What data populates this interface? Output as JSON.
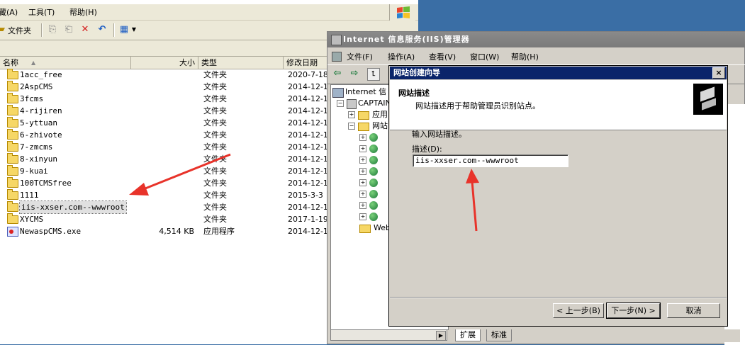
{
  "explorer": {
    "menu": [
      "藏(A)",
      "工具(T)",
      "帮助(H)"
    ],
    "toolbar_folders_label": "文件夹",
    "columns": {
      "name": "名称",
      "size": "大小",
      "type": "类型",
      "modified": "修改日期"
    },
    "rows": [
      {
        "name": "1acc_free",
        "size": "",
        "type": "文件夹",
        "date": "2020-7-18"
      },
      {
        "name": "2AspCMS",
        "size": "",
        "type": "文件夹",
        "date": "2014-12-1"
      },
      {
        "name": "3fcms",
        "size": "",
        "type": "文件夹",
        "date": "2014-12-1"
      },
      {
        "name": "4-rijiren",
        "size": "",
        "type": "文件夹",
        "date": "2014-12-1"
      },
      {
        "name": "5-yttuan",
        "size": "",
        "type": "文件夹",
        "date": "2014-12-1"
      },
      {
        "name": "6-zhivote",
        "size": "",
        "type": "文件夹",
        "date": "2014-12-1"
      },
      {
        "name": "7-zmcms",
        "size": "",
        "type": "文件夹",
        "date": "2014-12-1"
      },
      {
        "name": "8-xinyun",
        "size": "",
        "type": "文件夹",
        "date": "2014-12-1"
      },
      {
        "name": "9-kuai",
        "size": "",
        "type": "文件夹",
        "date": "2014-12-1"
      },
      {
        "name": "100TCMSfree",
        "size": "",
        "type": "文件夹",
        "date": "2014-12-1"
      },
      {
        "name": "1111",
        "size": "",
        "type": "文件夹",
        "date": "2015-3-3"
      },
      {
        "name": "iis-xxser.com--wwwroot",
        "size": "",
        "type": "文件夹",
        "date": "2014-12-1"
      },
      {
        "name": "XYCMS",
        "size": "",
        "type": "文件夹",
        "date": "2017-1-19"
      },
      {
        "name": "NewaspCMS.exe",
        "size": "4,514 KB",
        "type": "应用程序",
        "date": "2014-12-1"
      }
    ]
  },
  "iis": {
    "title": "Internet 信息服务(IIS)管理器",
    "menu": [
      "文件(F)",
      "操作(A)",
      "查看(V)",
      "窗口(W)",
      "帮助(H)"
    ],
    "tree": {
      "root": "Internet 信",
      "server": "CAPTAIN",
      "app_pools": "应用",
      "websites": "网站",
      "web_ext": "Web"
    },
    "tabs": [
      "扩展",
      "标准"
    ]
  },
  "wizard": {
    "title": "网站创建向导",
    "close": "×",
    "header_title": "网站描述",
    "header_subtitle": "网站描述用于帮助管理员识别站点。",
    "prompt": "输入网站描述。",
    "field_label": "描述(D):",
    "field_value": "iis-xxser.com--wwwroot",
    "back": "< 上一步(B)",
    "next": "下一步(N) >",
    "cancel": "取消"
  },
  "colors": {
    "accent_title": "#0a246a",
    "annotation_arrow": "#e8332a"
  }
}
